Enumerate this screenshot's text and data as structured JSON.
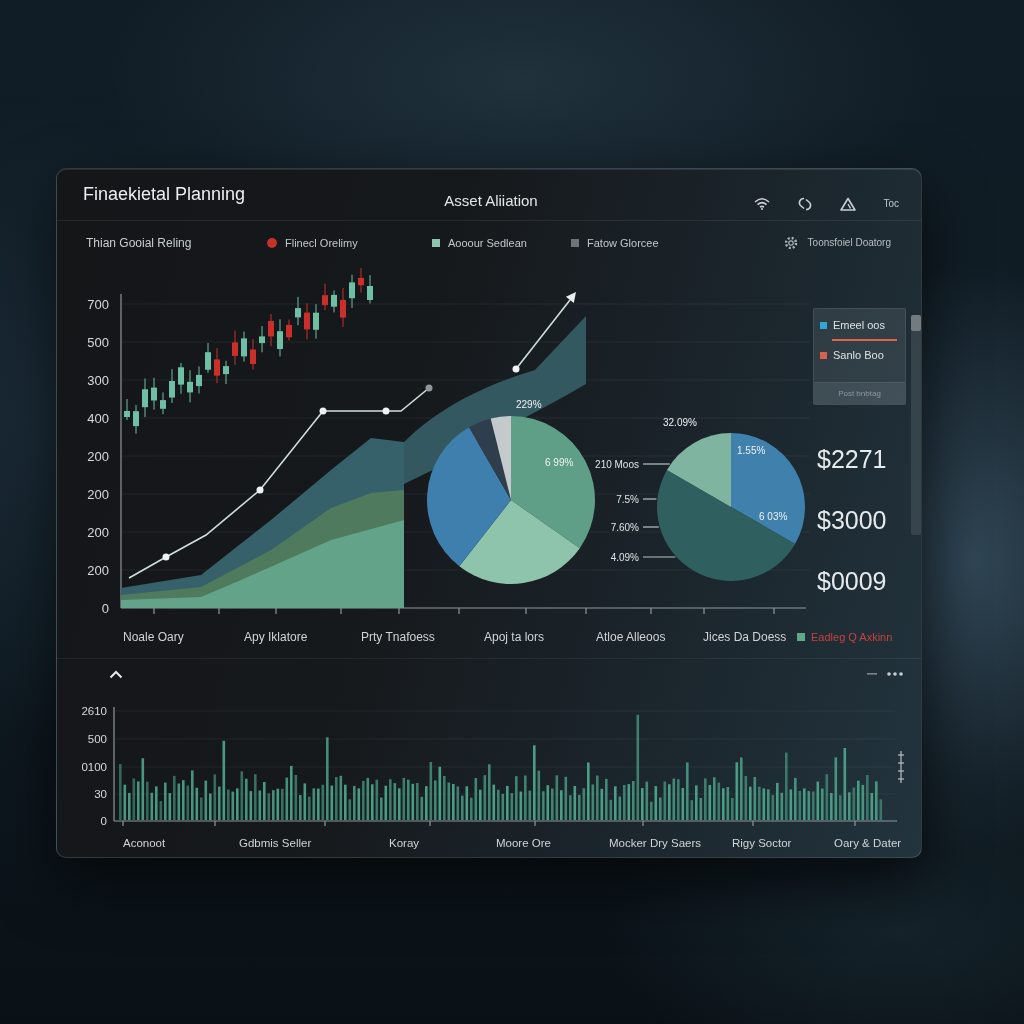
{
  "header": {
    "title": "Finaekietal Planning",
    "section_title": "Asset Aliiation",
    "menu_label": "Toc"
  },
  "legend": {
    "caption": "Thian Gooial Reling",
    "items": [
      {
        "kind": "dot",
        "label": "Flinecl Orelimy",
        "color": "#c8302a"
      },
      {
        "kind": "square",
        "label": "Aooour Sedlean",
        "color": "#8cc5b0"
      },
      {
        "kind": "square",
        "label": "Fatow Glorcee",
        "color": "#6e7378"
      }
    ]
  },
  "settings": {
    "label": "Toonsfoiel Doatorg"
  },
  "main_chart": {
    "y_labels": [
      "700",
      "500",
      "300",
      "400",
      "200",
      "200",
      "200",
      "200",
      "0"
    ],
    "pies": [
      {
        "labels": [
          "229%",
          "6 99%"
        ]
      },
      {
        "labels": [
          "32.09%",
          "1.55%",
          "6 03%"
        ],
        "callouts": [
          "210 Moos",
          "7.5%",
          "7.60%",
          "4.09%"
        ]
      }
    ],
    "x_labels": [
      "Noale Oary",
      "Apy Iklatore",
      "Prty Tnafoess",
      "Apoj ta lors",
      "Atloe Alleoos",
      "Jices Da Doess"
    ],
    "legend": {
      "label": "Eadleg Q Axkinn"
    }
  },
  "side_card": {
    "items": [
      {
        "label": "Emeel oos",
        "color": "#2fa8d8"
      },
      {
        "label": "Sanlo Boo",
        "color": "#d9604e"
      }
    ],
    "button": "Post bnbtag"
  },
  "amounts": [
    "$2271",
    "$3000",
    "$0009"
  ],
  "volume_chart": {
    "y_labels": [
      "2610",
      "500",
      "0100",
      "30",
      "0"
    ],
    "x_labels": [
      "Aconoot",
      "Gdbmis Seller",
      "Koray",
      "Moore Ore",
      "Mocker Dry Saers",
      "Rigy Soctor",
      "Oary & Dater"
    ]
  }
}
